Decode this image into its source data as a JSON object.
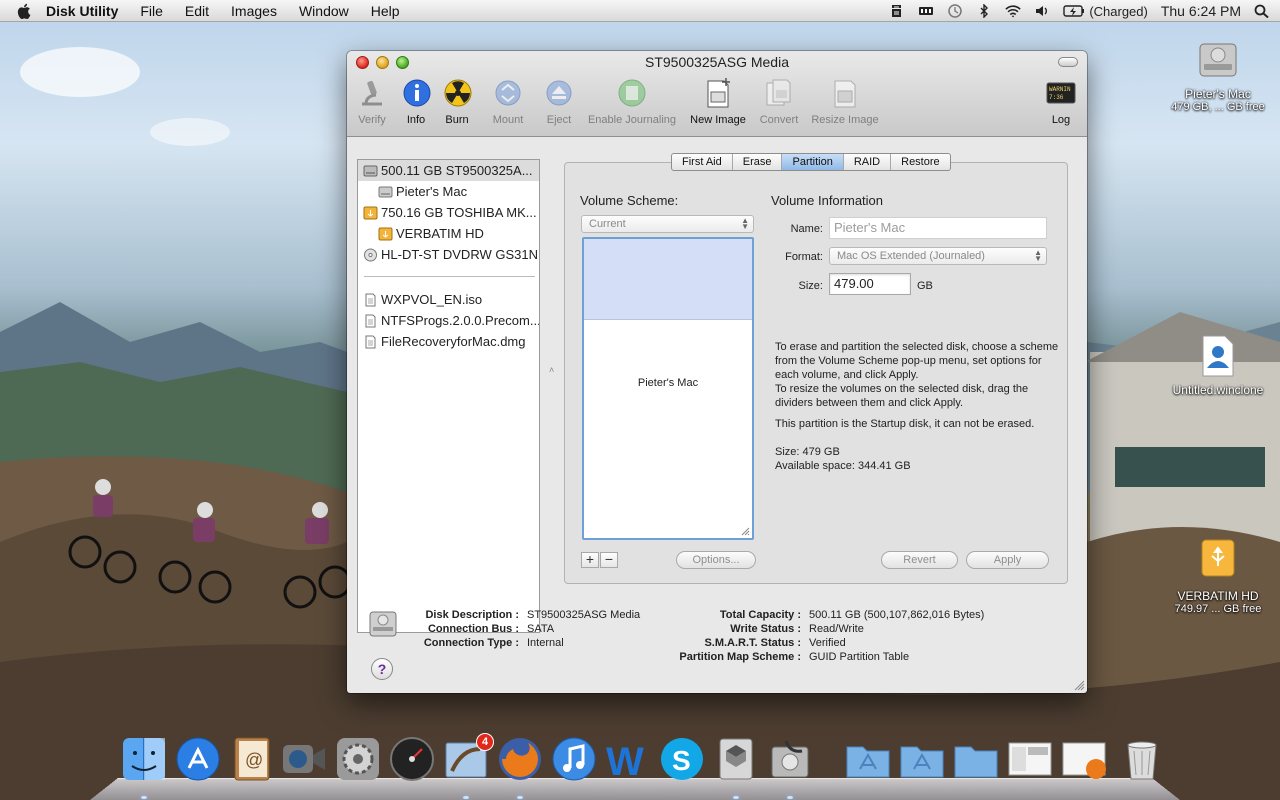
{
  "menubar": {
    "app_name": "Disk Utility",
    "menus": [
      "File",
      "Edit",
      "Images",
      "Window",
      "Help"
    ],
    "battery_status": "(Charged)",
    "clock": "Thu 6:24 PM"
  },
  "desktop_icons": [
    {
      "name": "Pieter's Mac",
      "sub": "479 GB, ... GB free"
    },
    {
      "name": "Untitled.winclone",
      "sub": ""
    },
    {
      "name": "VERBATIM HD",
      "sub": "749.97 ... GB free"
    }
  ],
  "window": {
    "title": "ST9500325ASG Media",
    "toolbar": [
      {
        "label": "Verify",
        "enabled": false
      },
      {
        "label": "Info",
        "enabled": true
      },
      {
        "label": "Burn",
        "enabled": true
      },
      {
        "label": "Mount",
        "enabled": false
      },
      {
        "label": "Eject",
        "enabled": false
      },
      {
        "label": "Enable Journaling",
        "enabled": false
      },
      {
        "label": "New Image",
        "enabled": true
      },
      {
        "label": "Convert",
        "enabled": false
      },
      {
        "label": "Resize Image",
        "enabled": false
      },
      {
        "label": "Log",
        "enabled": true
      }
    ],
    "log_icon_text": "WARNIN",
    "sidebar": {
      "disks": [
        {
          "label": "500.11 GB ST9500325A...",
          "selected": true,
          "child": false,
          "icon": "internal-disk-icon"
        },
        {
          "label": "Pieter's Mac",
          "selected": false,
          "child": true,
          "icon": "internal-volume-icon"
        },
        {
          "label": "750.16 GB TOSHIBA MK...",
          "selected": false,
          "child": false,
          "icon": "external-disk-icon"
        },
        {
          "label": "VERBATIM HD",
          "selected": false,
          "child": true,
          "icon": "external-volume-icon"
        },
        {
          "label": "HL-DT-ST DVDRW GS31N",
          "selected": false,
          "child": false,
          "icon": "optical-drive-icon"
        }
      ],
      "images": [
        {
          "label": "WXPVOL_EN.iso",
          "icon": "disk-image-file-icon"
        },
        {
          "label": "NTFSProgs.2.0.0.Precom...",
          "icon": "disk-image-file-icon"
        },
        {
          "label": "FileRecoveryforMac.dmg",
          "icon": "disk-image-file-icon"
        }
      ]
    },
    "tabs": [
      "First Aid",
      "Erase",
      "Partition",
      "RAID",
      "Restore"
    ],
    "active_tab": "Partition",
    "partition": {
      "volume_scheme_label": "Volume Scheme:",
      "scheme_value": "Current",
      "volume_info_label": "Volume Information",
      "name_label": "Name:",
      "name_value": "Pieter's Mac",
      "format_label": "Format:",
      "format_value": "Mac OS Extended (Journaled)",
      "size_label": "Size:",
      "size_value": "479.00",
      "size_unit": "GB",
      "partition_name": "Pieter's Mac",
      "help_text_1": "To erase and partition the selected disk, choose a scheme from the Volume Scheme pop-up menu, set options for each volume, and click Apply.",
      "help_text_2": "To resize the volumes on the selected disk, drag the dividers between them and click Apply.",
      "startup_note": "This partition is the Startup disk, it can not be erased.",
      "size_line": "Size: 479 GB",
      "available_line": "Available space: 344.41 GB",
      "add_label": "+",
      "remove_label": "−",
      "options_label": "Options...",
      "revert_label": "Revert",
      "apply_label": "Apply"
    },
    "disk_info": {
      "disk_description_label": "Disk Description :",
      "disk_description": "ST9500325ASG Media",
      "connection_bus_label": "Connection Bus :",
      "connection_bus": "SATA",
      "connection_type_label": "Connection Type :",
      "connection_type": "Internal",
      "total_capacity_label": "Total Capacity :",
      "total_capacity": "500.11 GB (500,107,862,016 Bytes)",
      "write_status_label": "Write Status :",
      "write_status": "Read/Write",
      "smart_status_label": "S.M.A.R.T. Status :",
      "smart_status": "Verified",
      "partition_map_label": "Partition Map Scheme :",
      "partition_map": "GUID Partition Table",
      "help_label": "?"
    }
  },
  "dock": {
    "items": [
      "Finder",
      "App Store",
      "Address Book",
      "FaceTime",
      "System Preferences",
      "Dashboard",
      "Mail",
      "Firefox",
      "iTunes",
      "Word",
      "Skype",
      "Boot Camp Assistant",
      "Disk Utility",
      "Applications",
      "Documents",
      "Downloads",
      "Screenshot",
      "Screenshot",
      "Trash"
    ],
    "mail_badge": "4"
  }
}
